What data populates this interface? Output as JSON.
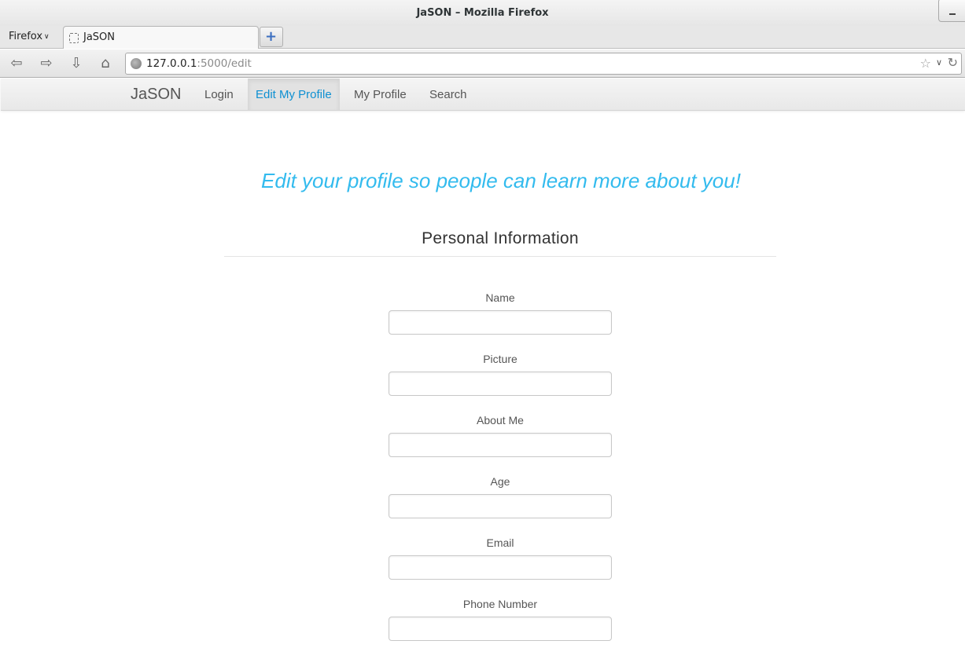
{
  "window": {
    "title": "JaSON – Mozilla Firefox"
  },
  "browser": {
    "menu_label": "Firefox",
    "tab_title": "JaSON",
    "url_host": "127.0.0.1",
    "url_rest": ":5000/edit"
  },
  "site": {
    "brand": "JaSON",
    "nav": [
      {
        "label": "Login"
      },
      {
        "label": "Edit My Profile"
      },
      {
        "label": "My Profile"
      },
      {
        "label": "Search"
      }
    ]
  },
  "page": {
    "tagline": "Edit your profile so people can learn more about you!",
    "section_title": "Personal Information",
    "fields": [
      {
        "label": "Name",
        "value": ""
      },
      {
        "label": "Picture",
        "value": ""
      },
      {
        "label": "About Me",
        "value": ""
      },
      {
        "label": "Age",
        "value": ""
      },
      {
        "label": "Email",
        "value": ""
      },
      {
        "label": "Phone Number",
        "value": ""
      }
    ]
  },
  "colors": {
    "accent": "#33bbee",
    "active_nav": "#0e90d2"
  }
}
